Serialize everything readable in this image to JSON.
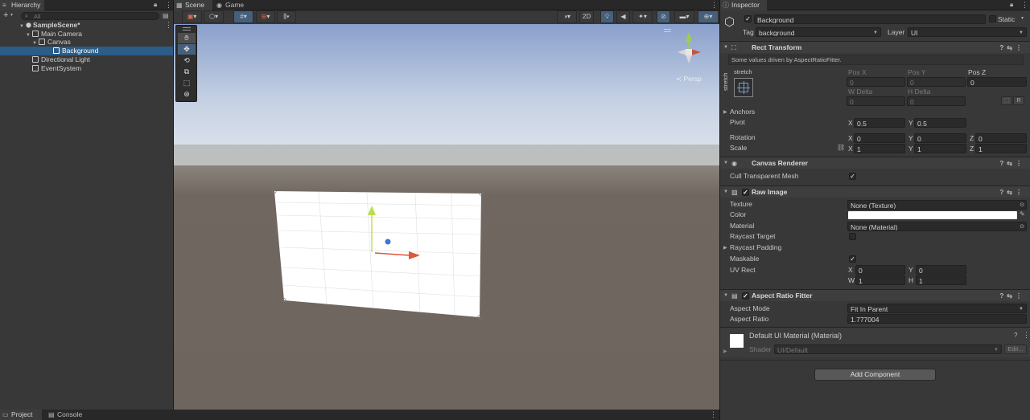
{
  "hierarchy": {
    "tab": "Hierarchy",
    "search_placeholder": "All",
    "scene": "SampleScene*",
    "items": [
      {
        "label": "Main Camera"
      },
      {
        "label": "Canvas"
      },
      {
        "label": "Background"
      },
      {
        "label": "Directional Light"
      },
      {
        "label": "EventSystem"
      }
    ]
  },
  "scene_view": {
    "tabs": [
      "Scene",
      "Game"
    ],
    "toggle_2d": "2D",
    "persp_label": "≺ Persp"
  },
  "bottom": {
    "tabs": [
      "Project",
      "Console"
    ]
  },
  "inspector": {
    "tab": "Inspector",
    "object_name": "Background",
    "static_label": "Static",
    "tag_label": "Tag",
    "tag_value": "background",
    "layer_label": "Layer",
    "layer_value": "UI",
    "rect_transform": {
      "title": "Rect Transform",
      "note": "Some values driven by AspectRatioFitter.",
      "anchor_preset": "stretch",
      "anchor_preset_side": "stretch",
      "pos_x_label": "Pos X",
      "pos_x": "0",
      "pos_y_label": "Pos Y",
      "pos_y": "0",
      "pos_z_label": "Pos Z",
      "pos_z": "0",
      "w_delta_label": "W Delta",
      "w_delta": "0",
      "h_delta_label": "H Delta",
      "h_delta": "0",
      "r_button": "R",
      "anchors_label": "Anchors",
      "pivot_label": "Pivot",
      "pivot_x": "0.5",
      "pivot_y": "0.5",
      "rotation_label": "Rotation",
      "rotation": {
        "x": "0",
        "y": "0",
        "z": "0"
      },
      "scale_label": "Scale",
      "scale": {
        "x": "1",
        "y": "1",
        "z": "1"
      },
      "axis": {
        "x": "X",
        "y": "Y",
        "z": "Z",
        "w": "W",
        "h": "H"
      }
    },
    "canvas_renderer": {
      "title": "Canvas Renderer",
      "cull_label": "Cull Transparent Mesh",
      "cull_checked": true
    },
    "raw_image": {
      "title": "Raw Image",
      "texture_label": "Texture",
      "texture_value": "None (Texture)",
      "color_label": "Color",
      "color_value": "#ffffff",
      "material_label": "Material",
      "material_value": "None (Material)",
      "raycast_target_label": "Raycast Target",
      "raycast_padding_label": "Raycast Padding",
      "maskable_label": "Maskable",
      "uv_rect_label": "UV Rect",
      "uv": {
        "x": "0",
        "y": "0",
        "w": "1",
        "h": "1"
      }
    },
    "aspect_ratio_fitter": {
      "title": "Aspect Ratio Fitter",
      "mode_label": "Aspect Mode",
      "mode_value": "Fit In Parent",
      "ratio_label": "Aspect Ratio",
      "ratio_value": "1.777004"
    },
    "material": {
      "title": "Default UI Material (Material)",
      "shader_label": "Shader",
      "shader_value": "UI/Default",
      "edit_label": "Edit..."
    },
    "add_component": "Add Component"
  },
  "colors": {
    "selection": "#2c5d87",
    "panel": "#383838",
    "sky_top": "#8da4cf",
    "ground": "#6f6660"
  }
}
